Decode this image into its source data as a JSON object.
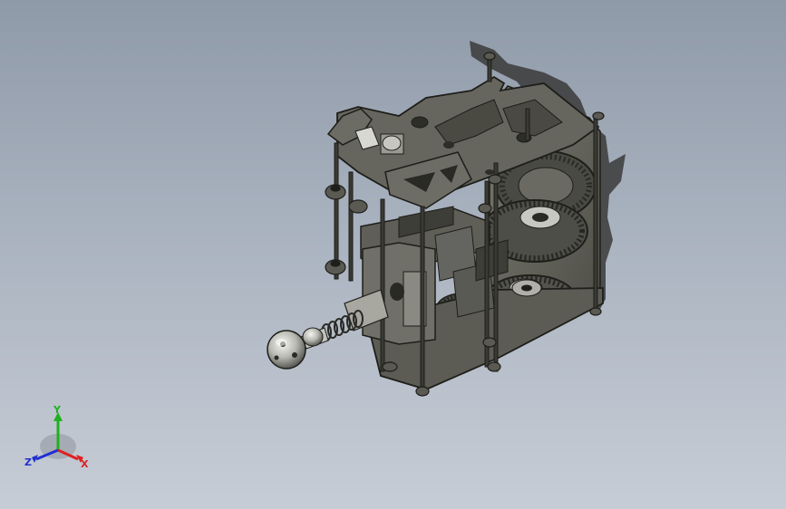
{
  "viewport": {
    "background_top": "#8f9aa8",
    "background_bottom": "#c7cdd6"
  },
  "model": {
    "part_color": "#5e5e56",
    "edge_color": "#1e1e1a",
    "metal_color": "#c9c9c4"
  },
  "triad": {
    "x_label": "X",
    "y_label": "Y",
    "z_label": "Z",
    "x_color": "#e02020",
    "y_color": "#20b020",
    "z_color": "#2030d0"
  }
}
